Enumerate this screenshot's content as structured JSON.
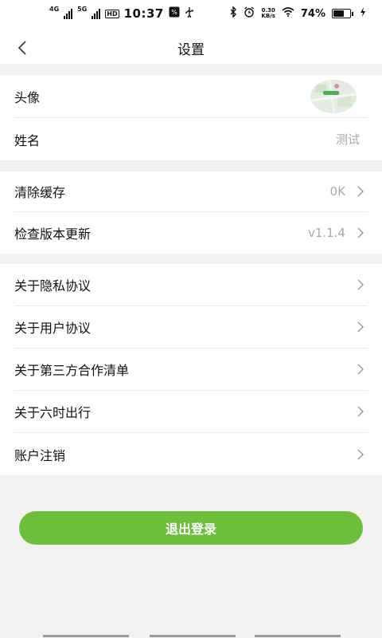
{
  "status_bar": {
    "net1": "4G",
    "net2": "5G",
    "hd": "HD",
    "time": "10:37",
    "speed_value": "0.30",
    "speed_unit": "KB/s",
    "battery_pct": "74%",
    "battery_level": 0.74
  },
  "header": {
    "title": "设置"
  },
  "profile": {
    "avatar_label": "头像",
    "name_label": "姓名",
    "name_value": "测试"
  },
  "system": {
    "cache_label": "清除缓存",
    "cache_value": "0K",
    "version_label": "检查版本更新",
    "version_value": "v1.1.4"
  },
  "about": {
    "items": [
      {
        "label": "关于隐私协议"
      },
      {
        "label": "关于用户协议"
      },
      {
        "label": "关于第三方合作清单"
      },
      {
        "label": "关于六时出行"
      },
      {
        "label": "账户注销"
      }
    ]
  },
  "logout": {
    "label": "退出登录"
  },
  "colors": {
    "accent": "#6cbf3a",
    "background": "#f2f2f2"
  }
}
